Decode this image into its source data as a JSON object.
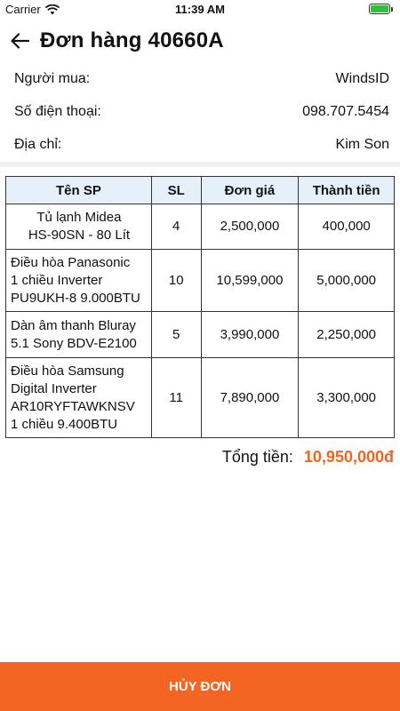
{
  "status_bar": {
    "carrier": "Carrier",
    "time": "11:39 AM"
  },
  "header": {
    "title": "Đơn hàng 40660A"
  },
  "buyer": {
    "rows": [
      {
        "label": "Người mua:",
        "value": "WindsID"
      },
      {
        "label": "Số điện thoại:",
        "value": "098.707.5454"
      },
      {
        "label": "Địa chỉ:",
        "value": "Kim Son"
      }
    ]
  },
  "table": {
    "headers": [
      "Tên SP",
      "SL",
      "Đơn giá",
      "Thành tiền"
    ],
    "rows": [
      {
        "name": "Tủ lạnh Midea\nHS-90SN - 80 Lít",
        "qty": "4",
        "price": "2,500,000",
        "total": "400,000"
      },
      {
        "name": "Điều hòa Panasonic\n1 chiều Inverter\nPU9UKH-8 9.000BTU",
        "qty": "10",
        "price": "10,599,000",
        "total": "5,000,000"
      },
      {
        "name": "Dàn âm thanh Bluray\n5.1 Sony BDV-E2100",
        "qty": "5",
        "price": "3,990,000",
        "total": "2,250,000"
      },
      {
        "name": "Điều hòa Samsung\nDigital Inverter\nAR10RYFTAWKNSV\n1 chiều 9.400BTU",
        "qty": "11",
        "price": "7,890,000",
        "total": "3,300,000"
      }
    ]
  },
  "summary": {
    "label": "Tổng tiền:",
    "value": "10,950,000đ"
  },
  "actions": {
    "cancel_label": "HỦY ĐƠN"
  },
  "colors": {
    "accent": "#f26522",
    "table_header_bg": "#e6f0fb",
    "battery": "#2ec23a"
  },
  "icons": {
    "back": "arrow-left-icon",
    "wifi": "wifi-icon",
    "battery": "battery-icon"
  }
}
